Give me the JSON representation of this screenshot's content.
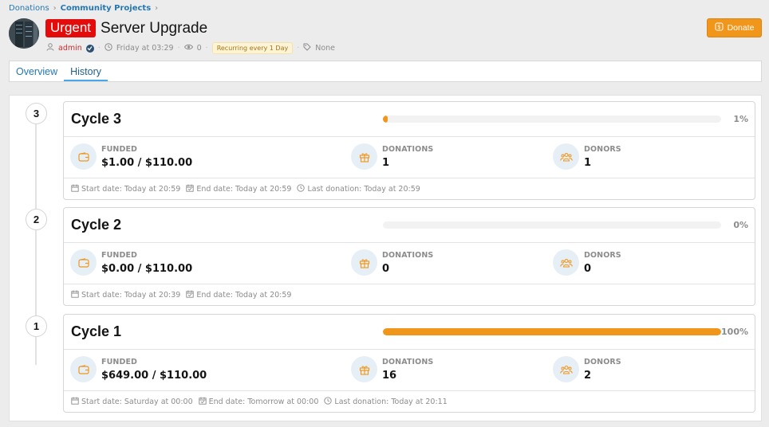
{
  "breadcrumb": [
    "Donations",
    "Community Projects"
  ],
  "thread": {
    "label": "Urgent",
    "title": "Server Upgrade",
    "author": "admin",
    "date": "Friday at 03:29",
    "views": "0",
    "recurring": "Recurring every 1 Day",
    "tags": "None"
  },
  "donate_label": "Donate",
  "tabs": [
    {
      "label": "Overview",
      "active": false
    },
    {
      "label": "History",
      "active": true
    }
  ],
  "stat_labels": {
    "funded": "FUNDED",
    "donations": "DONATIONS",
    "donors": "DONORS"
  },
  "date_labels": {
    "start": "Start date:",
    "end": "End date:",
    "last": "Last donation:"
  },
  "cycles": [
    {
      "number": "3",
      "title": "Cycle 3",
      "progress": 0.01,
      "percent": "1%",
      "funded": "$1.00 / $110.00",
      "donations": "1",
      "donors": "1",
      "start": "Today at 20:59",
      "end": "Today at 20:59",
      "last": "Today at 20:59"
    },
    {
      "number": "2",
      "title": "Cycle 2",
      "progress": 0,
      "percent": "0%",
      "funded": "$0.00 / $110.00",
      "donations": "0",
      "donors": "0",
      "start": "Today at 20:39",
      "end": "Today at 20:59",
      "last": ""
    },
    {
      "number": "1",
      "title": "Cycle 1",
      "progress": 1,
      "percent": "100%",
      "funded": "$649.00 / $110.00",
      "donations": "16",
      "donors": "2",
      "start": "Saturday at 00:00",
      "end": "Tomorrow at 00:00",
      "last": "Today at 20:11"
    }
  ],
  "colors": {
    "accent": "#f0961a",
    "link": "#2577b1",
    "urgent": "#e40b0b"
  }
}
